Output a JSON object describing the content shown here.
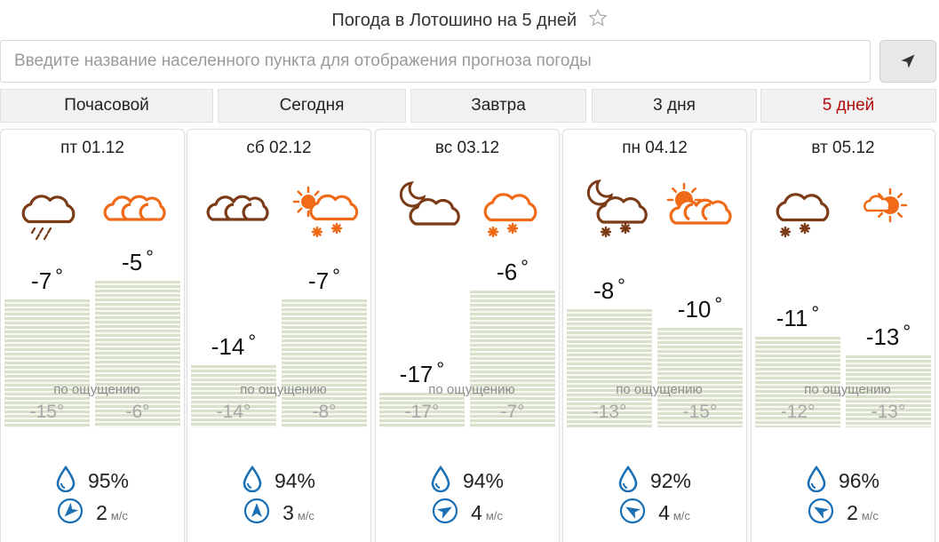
{
  "header": {
    "title": "Погода в Лотошино на 5 дней"
  },
  "search": {
    "placeholder": "Введите название населенного пункта для отображения прогноза погоды",
    "value": ""
  },
  "tabs": [
    {
      "label": "Почасовой",
      "active": false
    },
    {
      "label": "Сегодня",
      "active": false
    },
    {
      "label": "Завтра",
      "active": false
    },
    {
      "label": "3 дня",
      "active": false
    },
    {
      "label": "5 дней",
      "active": true
    }
  ],
  "colors": {
    "night": "#7a3b16",
    "day": "#f06a17",
    "active_tab": "#b40d0d"
  },
  "feels_label": "по ощущению",
  "days": [
    {
      "date": "пт 01.12",
      "night_icon": "cloud-rain-icon",
      "day_icon": "cloud-icon",
      "t_night": -7,
      "t_day": -5,
      "t_night_label": "-7",
      "t_day_label": "-5",
      "feel_night": "-15°",
      "feel_day": "-6°",
      "humidity": "95%",
      "wind": "2",
      "wind_unit": "м/с",
      "wind_dir_deg": 225
    },
    {
      "date": "сб 02.12",
      "night_icon": "cloud-icon",
      "day_icon": "sun-cloud-snow-icon",
      "t_night": -14,
      "t_day": -7,
      "t_night_label": "-14",
      "t_day_label": "-7",
      "feel_night": "-14°",
      "feel_day": "-8°",
      "humidity": "94%",
      "wind": "3",
      "wind_unit": "м/с",
      "wind_dir_deg": 0
    },
    {
      "date": "вс 03.12",
      "night_icon": "moon-cloud-icon",
      "day_icon": "cloud-snow-icon",
      "t_night": -17,
      "t_day": -6,
      "t_night_label": "-17",
      "t_day_label": "-6",
      "feel_night": "-17°",
      "feel_day": "-7°",
      "humidity": "94%",
      "wind": "4",
      "wind_unit": "м/с",
      "wind_dir_deg": 60
    },
    {
      "date": "пн 04.12",
      "night_icon": "moon-cloud-snow-icon",
      "day_icon": "sun-cloud-icon",
      "t_night": -8,
      "t_day": -10,
      "t_night_label": "-8",
      "t_day_label": "-10",
      "feel_night": "-13°",
      "feel_day": "-15°",
      "humidity": "92%",
      "wind": "4",
      "wind_unit": "м/с",
      "wind_dir_deg": 300
    },
    {
      "date": "вт 05.12",
      "night_icon": "cloud-snow-icon",
      "day_icon": "sun-small-cloud-icon",
      "t_night": -11,
      "t_day": -13,
      "t_night_label": "-11",
      "t_day_label": "-13",
      "feel_night": "-12°",
      "feel_day": "-13°",
      "humidity": "96%",
      "wind": "2",
      "wind_unit": "м/с",
      "wind_dir_deg": 300
    }
  ]
}
